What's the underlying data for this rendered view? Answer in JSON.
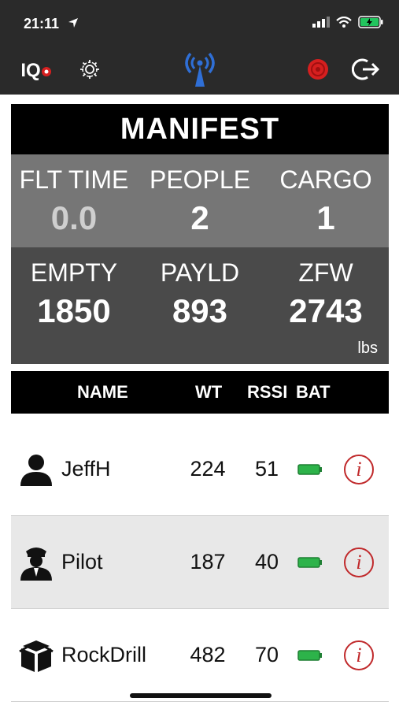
{
  "status": {
    "time": "21:11",
    "battery_color": "#22c55e"
  },
  "toolbar": {
    "logo_text": "IQ",
    "icons": [
      "logo-icon",
      "gear-icon",
      "antenna-icon",
      "alert-icon",
      "logout-icon"
    ],
    "antenna_color": "#2f6fd6",
    "alert_color": "#d61f1f"
  },
  "manifest": {
    "title": "MANIFEST",
    "flt_time_label": "FLT TIME",
    "flt_time_value": "0.0",
    "people_label": "PEOPLE",
    "people_value": "2",
    "cargo_label": "CARGO",
    "cargo_value": "1",
    "empty_label": "EMPTY",
    "empty_value": "1850",
    "payld_label": "PAYLD",
    "payld_value": "893",
    "zfw_label": "ZFW",
    "zfw_value": "2743",
    "units": "lbs"
  },
  "list": {
    "headers": {
      "name": "NAME",
      "wt": "WT",
      "rssi": "RSSI",
      "bat": "BAT"
    },
    "rows": [
      {
        "icon": "person-icon",
        "name": "JeffH",
        "wt": "224",
        "rssi": "51",
        "bat_icon": "battery-full-icon",
        "info": "i"
      },
      {
        "icon": "pilot-icon",
        "name": "Pilot",
        "wt": "187",
        "rssi": "40",
        "bat_icon": "battery-full-icon",
        "info": "i"
      },
      {
        "icon": "cargo-boxes-icon",
        "name": "RockDrill",
        "wt": "482",
        "rssi": "70",
        "bat_icon": "battery-full-icon",
        "info": "i"
      }
    ]
  }
}
